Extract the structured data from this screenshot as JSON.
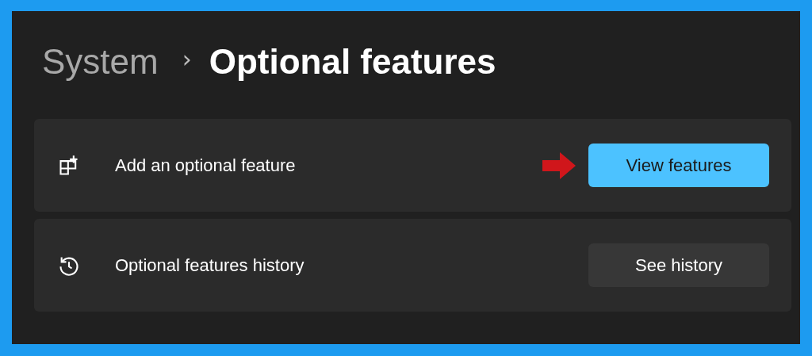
{
  "breadcrumb": {
    "parent": "System",
    "separator": "›",
    "current": "Optional features"
  },
  "cards": [
    {
      "kind": "add",
      "label": "Add an optional feature",
      "button": {
        "label": "View features",
        "primary": true
      },
      "annotated": true
    },
    {
      "kind": "history",
      "label": "Optional features history",
      "button": {
        "label": "See history",
        "primary": false
      },
      "annotated": false
    }
  ]
}
